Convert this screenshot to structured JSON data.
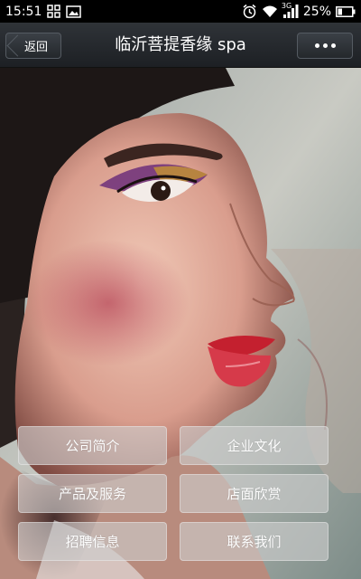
{
  "status_bar": {
    "time": "15:51",
    "icons": [
      "grid-icon",
      "image-icon",
      "alarm-icon",
      "wifi-icon",
      "signal-icon",
      "battery-icon"
    ],
    "network": "3G",
    "battery": "25%"
  },
  "nav": {
    "back_label": "返回",
    "title": "临沂菩提香缘 spa",
    "more_icon": "more-icon"
  },
  "menu": [
    {
      "label": "公司简介"
    },
    {
      "label": "企业文化"
    },
    {
      "label": "产品及服务"
    },
    {
      "label": "店面欣赏"
    },
    {
      "label": "招聘信息"
    },
    {
      "label": "联系我们"
    }
  ],
  "colors": {
    "nav_bg": "#2a2e33",
    "button_bg": "#cdcdcd",
    "lip": "#c4202f"
  }
}
